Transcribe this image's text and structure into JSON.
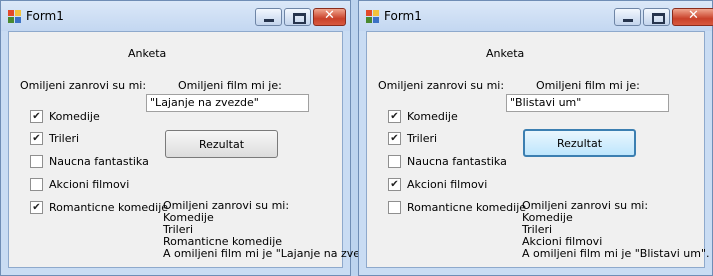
{
  "windows": [
    {
      "title": "Form1",
      "survey_label": "Anketa",
      "genres_label": "Omiljeni zanrovi su mi:",
      "film_label": "Omiljeni film mi je:",
      "film_value": "\"Lajanje na zvezde\"",
      "checkboxes": [
        {
          "label": "Komedije",
          "checked": true
        },
        {
          "label": "Trileri",
          "checked": true
        },
        {
          "label": "Naucna fantastika",
          "checked": false
        },
        {
          "label": "Akcioni filmovi",
          "checked": false
        },
        {
          "label": "Romanticne komedije",
          "checked": true
        }
      ],
      "button": "Rezultat",
      "output": [
        "Omiljeni zanrovi su mi:",
        "Komedije",
        "Trileri",
        "Romanticne komedije",
        "A omiljeni film mi je \"Lajanje na zvezde\""
      ]
    },
    {
      "title": "Form1",
      "survey_label": "Anketa",
      "genres_label": "Omiljeni zanrovi su mi:",
      "film_label": "Omiljeni film mi je:",
      "film_value": "\"Blistavi um\"",
      "checkboxes": [
        {
          "label": "Komedije",
          "checked": true
        },
        {
          "label": "Trileri",
          "checked": true
        },
        {
          "label": "Naucna fantastika",
          "checked": false
        },
        {
          "label": "Akcioni filmovi",
          "checked": true
        },
        {
          "label": "Romanticne komedije",
          "checked": false
        }
      ],
      "button": "Rezultat",
      "output": [
        "Omiljeni zanrovi su mi:",
        "Komedije",
        "Trileri",
        "Akcioni filmovi",
        "A omiljeni film mi je \"Blistavi um\"."
      ]
    }
  ],
  "icons": {
    "app": "form-app-icon",
    "minimize": "minimize-icon",
    "maximize": "maximize-icon",
    "close": "close-icon",
    "check": "checkmark-icon"
  },
  "glyphs": {
    "close": "✕",
    "check": "✔"
  },
  "colors": {
    "frame": "#c9dcf3",
    "client": "#f0f0f0",
    "close_button": "#c9412a",
    "focus_border": "#3c7fb1"
  }
}
